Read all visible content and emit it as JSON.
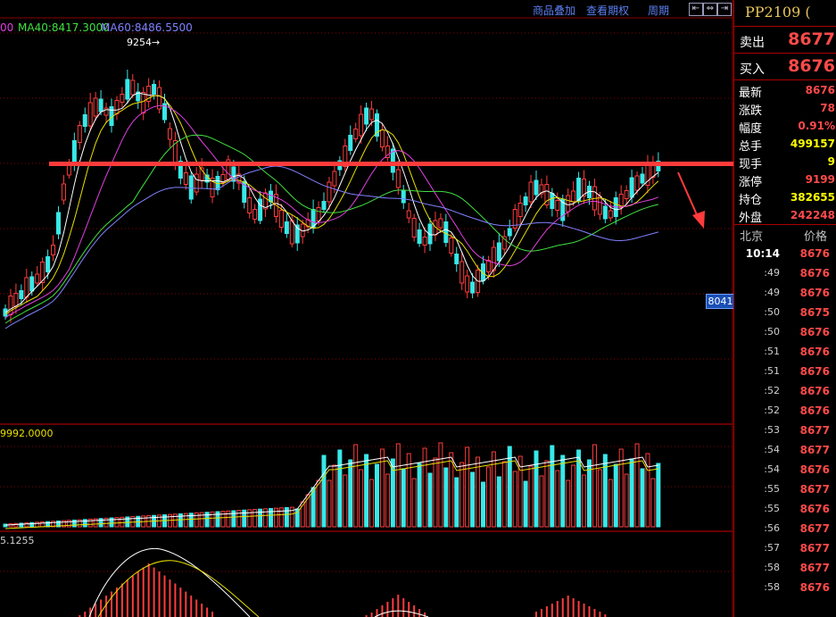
{
  "toolbar": {
    "overlay_label": "商品叠加",
    "options_label": "查看期权",
    "period_label": "周期",
    "nav_icons": [
      "arrow-left-icon",
      "arrow-both-icon",
      "arrow-right-icon"
    ]
  },
  "legend": {
    "ma_cut": "00",
    "ma40": "MA40:8417.3000",
    "ma60": "MA60:8486.5500",
    "vol_value": "9992.0000",
    "macd_value": "5.1255",
    "max_marker": "9254→",
    "price_tag": "8041"
  },
  "colors": {
    "up": "#ff3c3c",
    "down": "#38e8e8",
    "ma5": "#ffffff",
    "ma10": "#e8e000",
    "ma20": "#e040e0",
    "ma40": "#40e040",
    "ma60": "#8080ff",
    "accent_line": "#ff3b3b",
    "grid": "#8b0000"
  },
  "side": {
    "title": "PP2109 (",
    "sell_label": "卖出",
    "sell_price": "8677",
    "buy_label": "买入",
    "buy_price": "8676",
    "quote": [
      {
        "label": "最新",
        "value": "8676",
        "color": "#ff4a4a"
      },
      {
        "label": "涨跌",
        "value": "78",
        "color": "#ff4a4a"
      },
      {
        "label": "幅度",
        "value": "0.91%",
        "color": "#ff4a4a"
      },
      {
        "label": "总手",
        "value": "499157",
        "color": "#ffff00"
      },
      {
        "label": "现手",
        "value": "9",
        "color": "#ffff00"
      },
      {
        "label": "涨停",
        "value": "9199",
        "color": "#ff4a4a"
      },
      {
        "label": "持仓",
        "value": "382655",
        "color": "#ffff00"
      },
      {
        "label": "外盘",
        "value": "242248",
        "color": "#ff4a4a"
      }
    ],
    "ticks_header_left": "北京",
    "ticks_header_right": "价格",
    "ticks": [
      {
        "time": "10:14",
        "price": "8676"
      },
      {
        "time": ":49",
        "price": "8676"
      },
      {
        "time": ":49",
        "price": "8676"
      },
      {
        "time": ":50",
        "price": "8675"
      },
      {
        "time": ":50",
        "price": "8676"
      },
      {
        "time": ":51",
        "price": "8676"
      },
      {
        "time": ":51",
        "price": "8676"
      },
      {
        "time": ":52",
        "price": "8676"
      },
      {
        "time": ":52",
        "price": "8676"
      },
      {
        "time": ":53",
        "price": "8677"
      },
      {
        "time": ":54",
        "price": "8677"
      },
      {
        "time": ":54",
        "price": "8676"
      },
      {
        "time": ":55",
        "price": "8677"
      },
      {
        "time": ":55",
        "price": "8676"
      },
      {
        "time": ":56",
        "price": "8677"
      },
      {
        "time": ":57",
        "price": "8677"
      },
      {
        "time": ":58",
        "price": "8677"
      },
      {
        "time": ":58",
        "price": "8676"
      }
    ]
  }
}
